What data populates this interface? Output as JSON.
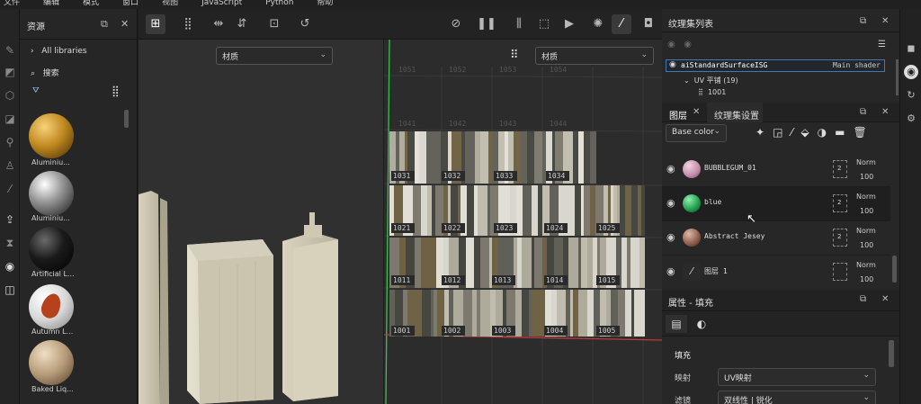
{
  "menu": [
    "文件",
    "编辑",
    "模式",
    "窗口",
    "视图",
    "JavaScript",
    "Python",
    "帮助"
  ],
  "assets": {
    "title": "资源",
    "all_libraries": "All libraries",
    "search_label": "搜索",
    "items": [
      {
        "label": "Aluminiu..."
      },
      {
        "label": "Aluminiu..."
      },
      {
        "label": "Artificial L..."
      },
      {
        "label": "Autumn L..."
      },
      {
        "label": "Baked Liq..."
      }
    ]
  },
  "viewport": {
    "left_material": "材质",
    "right_material": "材质"
  },
  "uv_tiles": {
    "ghost_labels": [
      "1051",
      "1052",
      "1053",
      "1054",
      "1041",
      "1042",
      "1043",
      "1044"
    ],
    "labels": [
      "1031",
      "1032",
      "1033",
      "1034",
      "1021",
      "1022",
      "1023",
      "1024",
      "1025",
      "1011",
      "1012",
      "1013",
      "1014",
      "1015",
      "1001",
      "1002",
      "1003",
      "1004",
      "1005"
    ]
  },
  "texture_sets": {
    "title": "纹理集列表",
    "row_name": "aiStandardSurfaceISG",
    "row_shader": "Main shader",
    "uv_label": "UV 平铺 (19)",
    "uv_sub": "1001"
  },
  "layers": {
    "tab_layers": "图层",
    "tab_settings": "纹理集设置",
    "channel": "Base color",
    "items": [
      {
        "name": "BUBBLEGUM_01",
        "blend": "Norm",
        "opacity": "100",
        "mask": "2"
      },
      {
        "name": "blue",
        "blend": "Norm",
        "opacity": "100",
        "mask": "2"
      },
      {
        "name": "Abstract Jesey",
        "blend": "Norm",
        "opacity": "100",
        "mask": "2"
      },
      {
        "name": "图层 1",
        "blend": "Norm",
        "opacity": "100",
        "mask": ""
      }
    ]
  },
  "properties": {
    "title": "属性 - 填充",
    "section": "填充",
    "mapping_label": "映射",
    "mapping_value": "UV映射",
    "filter_label": "滤镜",
    "filter_value": "双线性 | 锐化"
  },
  "colors": {
    "accent": "#2f6fb0",
    "panel": "#272727",
    "uv_green": "#39c24a",
    "uv_red": "#c23939"
  }
}
